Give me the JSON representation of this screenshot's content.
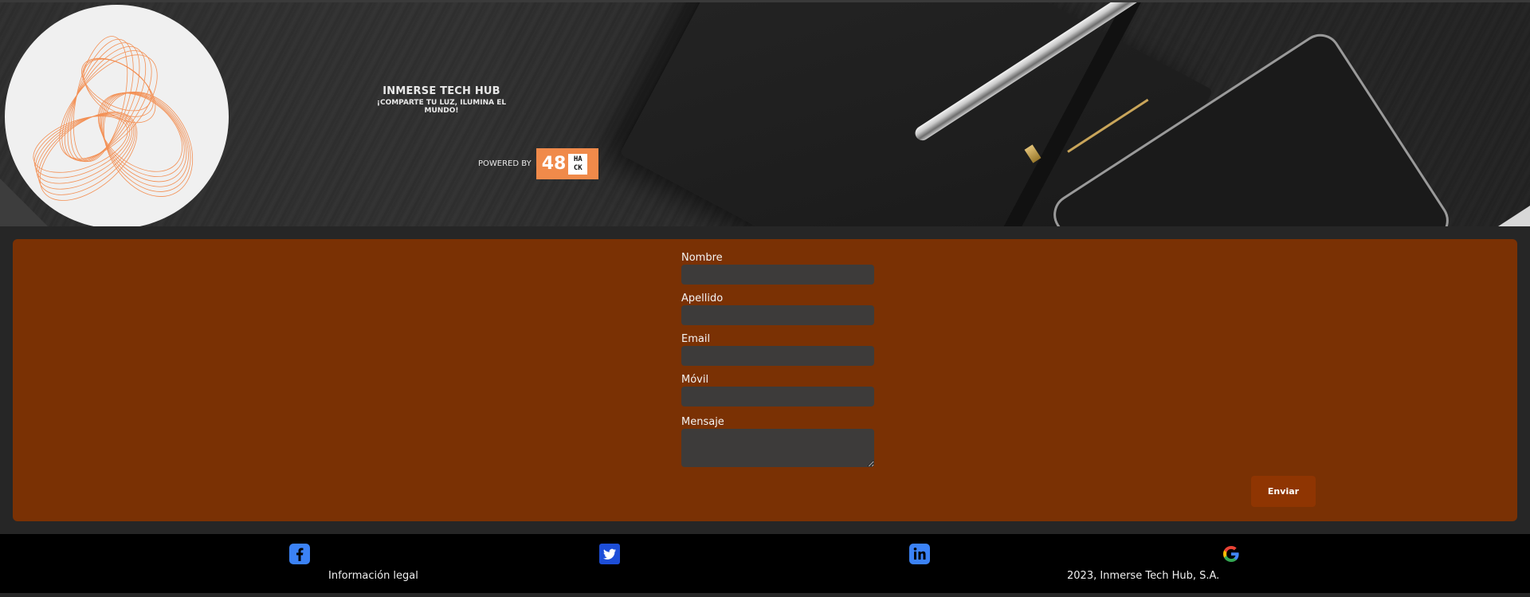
{
  "header": {
    "brand_title": "INMERSE TECH HUB",
    "brand_tagline": "¡COMPARTE TU LUZ, ILUMINA EL MUNDO!",
    "powered_label": "POWERED BY",
    "badge_number": "48",
    "badge_text": "HACK",
    "badge_color": "#f08a4a",
    "logo_color": "#f38b4c"
  },
  "form": {
    "panel_color": "#7a3104",
    "fields": [
      {
        "label": "Nombre",
        "value": ""
      },
      {
        "label": "Apellido",
        "value": ""
      },
      {
        "label": "Email",
        "value": ""
      },
      {
        "label": "Móvil",
        "value": ""
      },
      {
        "label": "Mensaje",
        "value": ""
      }
    ],
    "submit_label": "Enviar"
  },
  "footer": {
    "icons": [
      "facebook-icon",
      "twitter-icon",
      "linkedin-icon",
      "google-icon"
    ],
    "legal_link": "Información legal",
    "copyright": "2023, Inmerse Tech Hub, S.A."
  }
}
